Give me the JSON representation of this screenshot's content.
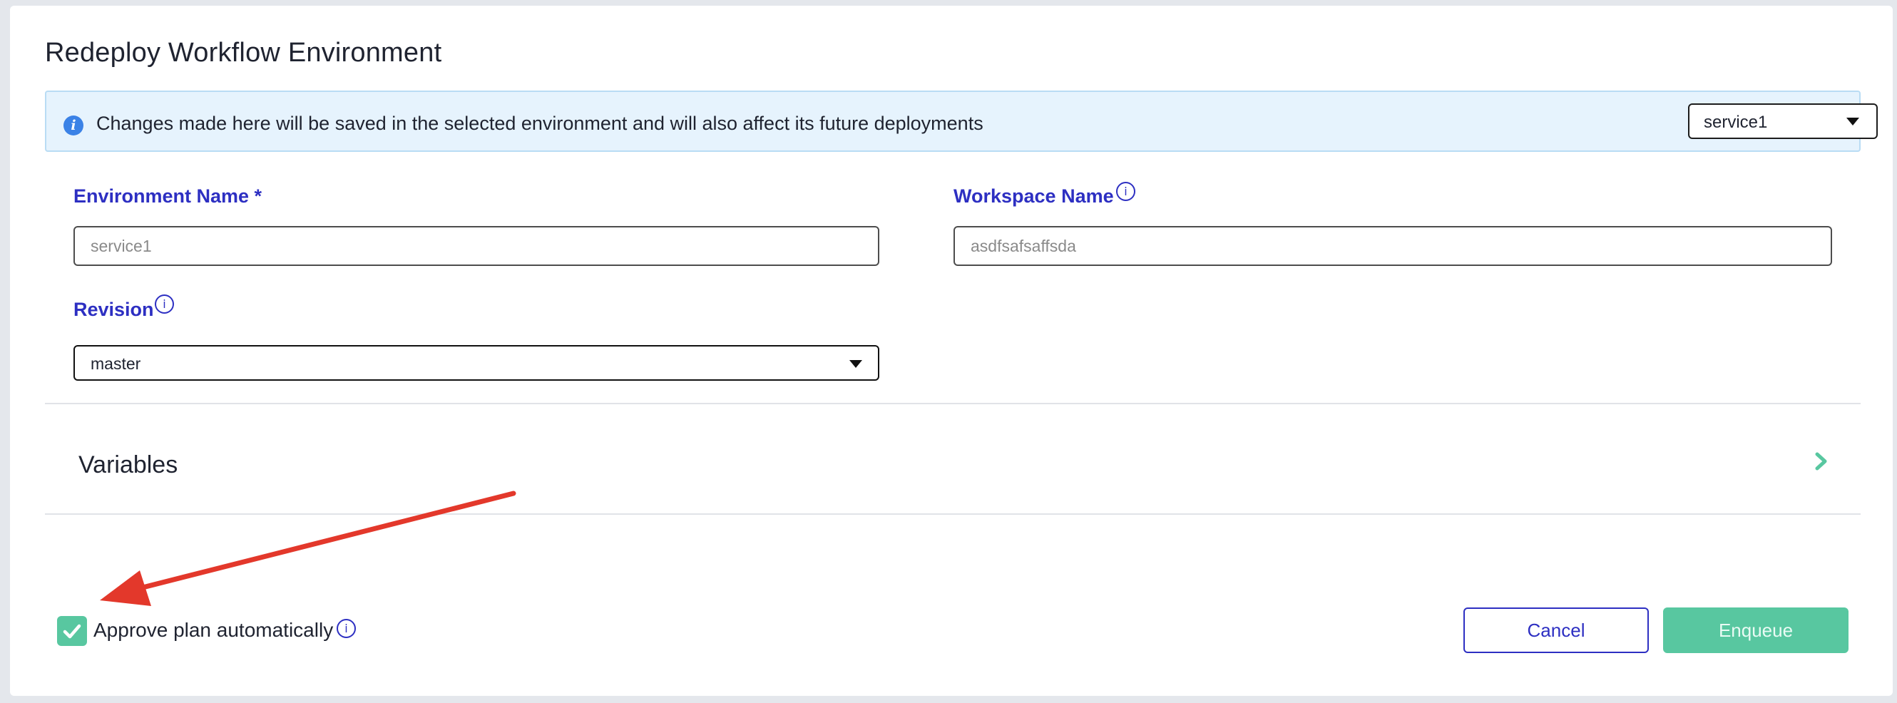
{
  "dialog": {
    "title": "Redeploy Workflow Environment"
  },
  "banner": {
    "icon": "info-icon",
    "message": "Changes made here will be saved in the selected environment and will also affect its future deployments",
    "environment_select": {
      "selected": "service1"
    }
  },
  "form": {
    "environment_name": {
      "label": "Environment Name *",
      "placeholder": "service1"
    },
    "workspace_name": {
      "label": "Workspace Name",
      "placeholder": "asdfsafsaffsda"
    },
    "revision": {
      "label": "Revision",
      "selected": "master"
    }
  },
  "variables": {
    "label": "Variables",
    "icon": "chevron-right-icon"
  },
  "footer": {
    "approve_label": "Approve plan automatically",
    "approve_checked": true,
    "cancel_label": "Cancel",
    "enqueue_label": "Enqueue"
  },
  "colors": {
    "accent_primary": "#2d2fc2",
    "accent_success": "#58c7a0",
    "banner_bg": "#e6f3fd",
    "annotation_arrow": "#e3382b"
  }
}
